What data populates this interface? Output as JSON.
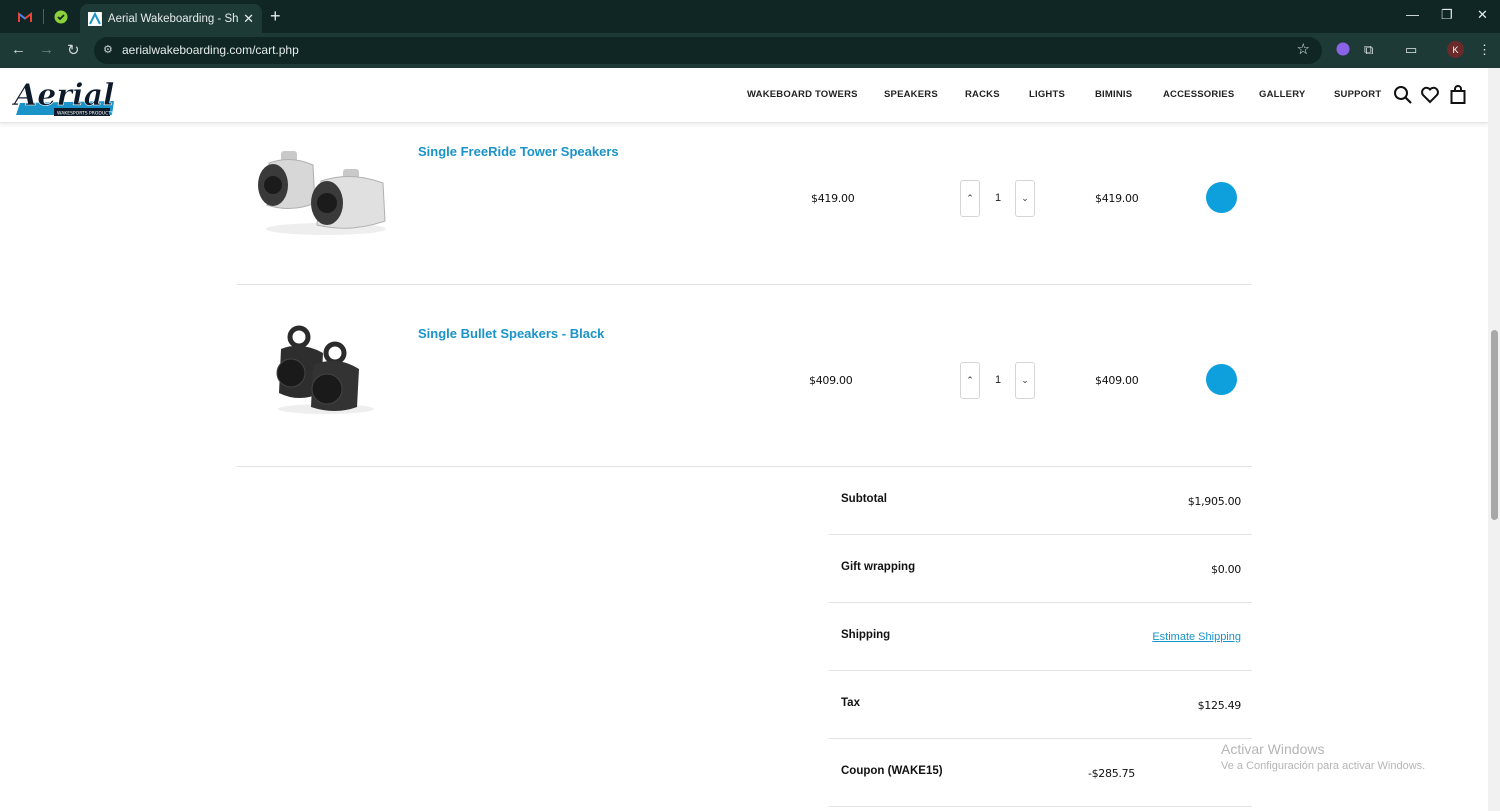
{
  "browser": {
    "tab_title": "Aerial Wakeboarding - Shopping Cart",
    "url": "aerialwakeboarding.com/cart.php",
    "avatar_letter": "K"
  },
  "header": {
    "logo_text": "Aerial",
    "logo_subtext": "WAKESPORTS PRODUCTS",
    "nav": [
      "WAKEBOARD TOWERS",
      "SPEAKERS",
      "RACKS",
      "LIGHTS",
      "BIMINIS",
      "ACCESSORIES",
      "GALLERY",
      "SUPPORT"
    ]
  },
  "cart": {
    "items": [
      {
        "name": "Single FreeRide Tower Speakers",
        "price": "$419.00",
        "quantity": "1",
        "total": "$419.00",
        "image_icon": "silver-tower-speakers-image"
      },
      {
        "name": "Single Bullet Speakers - Black",
        "price": "$409.00",
        "quantity": "1",
        "total": "$409.00",
        "image_icon": "black-bullet-speakers-image"
      }
    ]
  },
  "totals": {
    "subtotal_label": "Subtotal",
    "subtotal": "$1,905.00",
    "gift_label": "Gift wrapping",
    "gift": "$0.00",
    "shipping_label": "Shipping",
    "shipping_link": "Estimate Shipping",
    "tax_label": "Tax",
    "tax": "$125.49",
    "coupon_label": "Coupon (WAKE15)",
    "coupon": "-$285.75"
  },
  "watermark": {
    "line1": "Activar Windows",
    "line2": "Ve a Configuración para activar Windows."
  },
  "colors": {
    "accent": "#0ea0dc",
    "link": "#1a93c8",
    "chrome_dark": "#0f2624",
    "chrome_toolbar": "#1e3a37"
  }
}
